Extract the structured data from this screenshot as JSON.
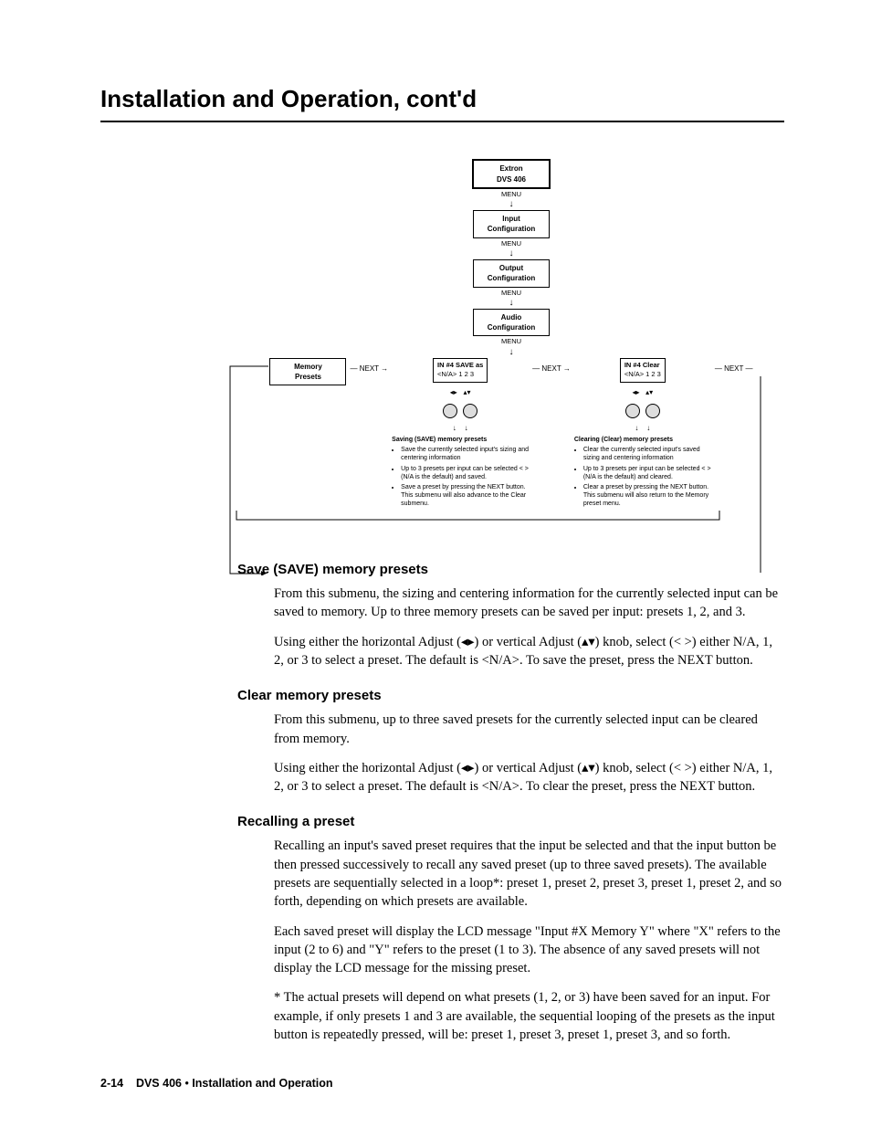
{
  "title": "Installation and Operation, cont'd",
  "diagram": {
    "start": "Extron\nDVS 406",
    "menu": "MENU",
    "nodes": [
      "Input\nConfiguration",
      "Output\nConfiguration",
      "Audio\nConfiguration",
      "Memory\nPresets"
    ],
    "next": "NEXT",
    "save_box": {
      "l1": "IN  #4    SAVE as",
      "l2": "<N/A> 1    2    3"
    },
    "clear_box": {
      "l1": "IN  #4   Clear",
      "l2": "<N/A> 1   2   3"
    },
    "save_hdr": "Saving (SAVE) memory presets",
    "save_bullets": [
      "Save the currently selected input's sizing and centering information",
      "Up to 3 presets per input can be selected < > (N/A is the default) and saved.",
      "Save a preset by pressing the NEXT button.  This submenu will also advance to the Clear submenu."
    ],
    "clear_hdr": "Clearing (Clear) memory presets",
    "clear_bullets": [
      "Clear the currently selected input's saved sizing and centering information",
      "Up to 3 presets per input can be selected < > (N/A is the default) and cleared.",
      "Clear a preset by pressing the NEXT button.  This submenu will also return to the Memory preset menu."
    ]
  },
  "sections": {
    "save": {
      "hdr": "Save (SAVE) memory presets",
      "p1": "From this submenu, the sizing and centering information for the currently selected input can be saved to memory.  Up to three memory presets can be saved per input: presets 1, 2, and 3.",
      "p2": "Using either the horizontal Adjust (◂▸) or vertical Adjust (▴▾) knob, select (< >) either N/A, 1, 2, or 3 to select a preset.  The default is <N/A>.  To save the preset, press the NEXT button."
    },
    "clear": {
      "hdr": "Clear memory presets",
      "p1": "From this submenu, up to three saved presets for the currently selected input can be cleared from memory.",
      "p2": "Using either the horizontal Adjust (◂▸) or vertical Adjust (▴▾) knob, select (< >) either N/A, 1, 2, or 3 to select a preset.  The default is <N/A>.  To clear the preset, press the NEXT button."
    },
    "recall": {
      "hdr": "Recalling a preset",
      "p1": "Recalling an input's saved preset requires that the input be selected and that the input button be then pressed successively to recall any saved preset (up to three saved presets).  The available presets are sequentially selected in a loop*: preset 1, preset 2, preset 3, preset 1, preset 2, and so forth, depending on which presets are available.",
      "p2": "Each saved preset will display the LCD message \"Input #X Memory Y\" where \"X\" refers to the input (2 to 6) and \"Y\" refers to the preset (1 to 3).  The absence of any saved presets will not display the LCD message for the missing preset.",
      "p3": "* The actual presets will depend on what presets (1, 2, or 3) have been saved for an input.  For example, if only presets 1 and 3 are available, the sequential looping of the presets as the input button is repeatedly pressed, will be:  preset 1, preset 3, preset 1, preset 3, and so forth."
    }
  },
  "footer": {
    "page": "2-14",
    "product": "DVS 406",
    "bullet": "•",
    "chapter": "Installation and Operation"
  }
}
